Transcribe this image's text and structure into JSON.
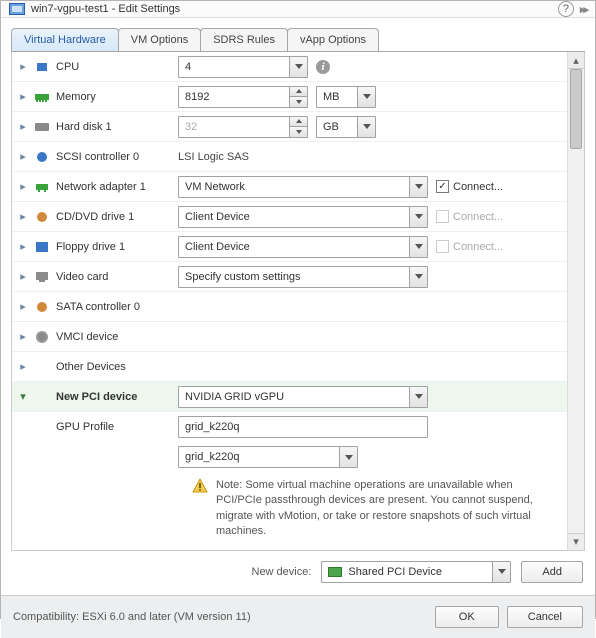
{
  "window": {
    "title": "win7-vgpu-test1 - Edit Settings"
  },
  "tabs": [
    "Virtual Hardware",
    "VM Options",
    "SDRS Rules",
    "vApp Options"
  ],
  "rows": {
    "cpu": {
      "label": "CPU",
      "value": "4"
    },
    "memory": {
      "label": "Memory",
      "value": "8192",
      "unit": "MB"
    },
    "hdd": {
      "label": "Hard disk 1",
      "value": "32",
      "unit": "GB"
    },
    "scsi": {
      "label": "SCSI controller 0",
      "text": "LSI Logic SAS"
    },
    "net": {
      "label": "Network adapter 1",
      "value": "VM Network",
      "connect": "Connect..."
    },
    "cd": {
      "label": "CD/DVD drive 1",
      "value": "Client Device",
      "connect": "Connect..."
    },
    "floppy": {
      "label": "Floppy drive 1",
      "value": "Client Device",
      "connect": "Connect..."
    },
    "video": {
      "label": "Video card",
      "value": "Specify custom settings"
    },
    "sata": {
      "label": "SATA controller 0"
    },
    "vmci": {
      "label": "VMCI device"
    },
    "other": {
      "label": "Other Devices"
    },
    "pci": {
      "label": "New PCI device",
      "value": "NVIDIA GRID vGPU"
    },
    "gpuprof": {
      "label": "GPU Profile",
      "text": "grid_k220q",
      "combo": "grid_k220q"
    }
  },
  "warning": "Note: Some virtual machine operations are unavailable when PCI/PCIe passthrough devices are present. You cannot suspend, migrate with vMotion, or take or restore snapshots of such virtual machines.",
  "newDevice": {
    "label": "New device:",
    "value": "Shared PCI Device",
    "add": "Add"
  },
  "footer": {
    "compat": "Compatibility: ESXi 6.0 and later (VM version 11)",
    "ok": "OK",
    "cancel": "Cancel"
  }
}
